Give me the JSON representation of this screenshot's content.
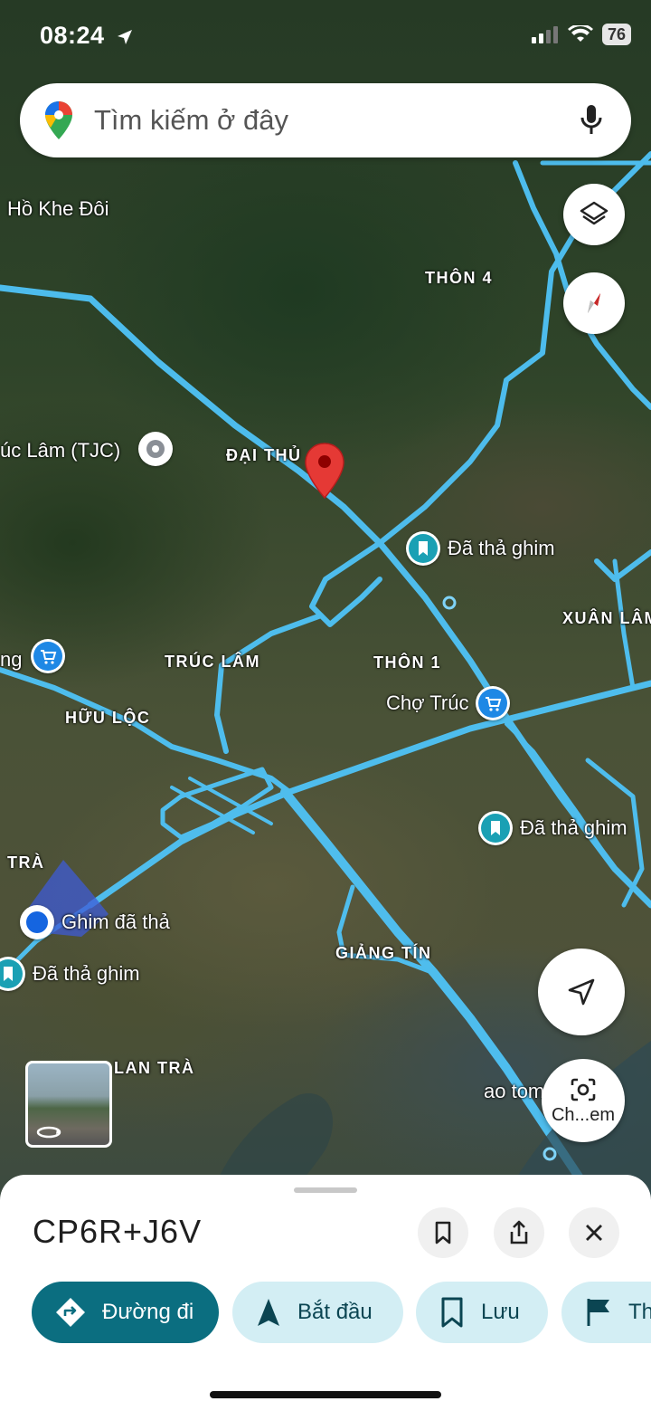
{
  "status_bar": {
    "time": "08:24",
    "battery": "76"
  },
  "search": {
    "placeholder": "Tìm kiếm ở đây"
  },
  "map_labels": {
    "ho_khe_doi": "Hồ Khe Đôi",
    "thon_4": "THÔN 4",
    "truc_lam_tjc": "úc Lâm (TJC)",
    "dai_thu": "ĐẠI THỦ",
    "xuan_lam": "XUÂN LÂM",
    "truc_lam": "TRÚC LÂM",
    "thon_1": "THÔN 1",
    "huu_loc": "HỮU LỘC",
    "tra": "TRÀ",
    "giang_tin": "GIẢNG TÍN",
    "lan_tra": "LAN TRÀ",
    "ao_tom": "ao tom",
    "left_ng": "ng"
  },
  "pois": {
    "pin1": "Đã thả ghim",
    "cho_truc": "Chợ Trúc",
    "pin2": "Đã thả ghim",
    "ghim_da_tha": "Ghim đã thả",
    "pin3": "Đã thả ghim"
  },
  "map_buttons": {
    "search_area_label": "Ch...em"
  },
  "sheet": {
    "plus_code": "CP6R+J6V",
    "chips": [
      {
        "label": "Đường đi",
        "icon": "directions-icon"
      },
      {
        "label": "Bắt đầu",
        "icon": "navigation-arrow-icon"
      },
      {
        "label": "Lưu",
        "icon": "bookmark-icon"
      },
      {
        "label": "Th",
        "icon": "flag-icon"
      }
    ]
  },
  "colors": {
    "road": "#4fc3f7",
    "accent": "#0b6e80",
    "chip_secondary": "#d3eef4",
    "pin_red": "#e53935",
    "poi_teal": "#1aa0b4",
    "user_blue": "#1565e0"
  }
}
